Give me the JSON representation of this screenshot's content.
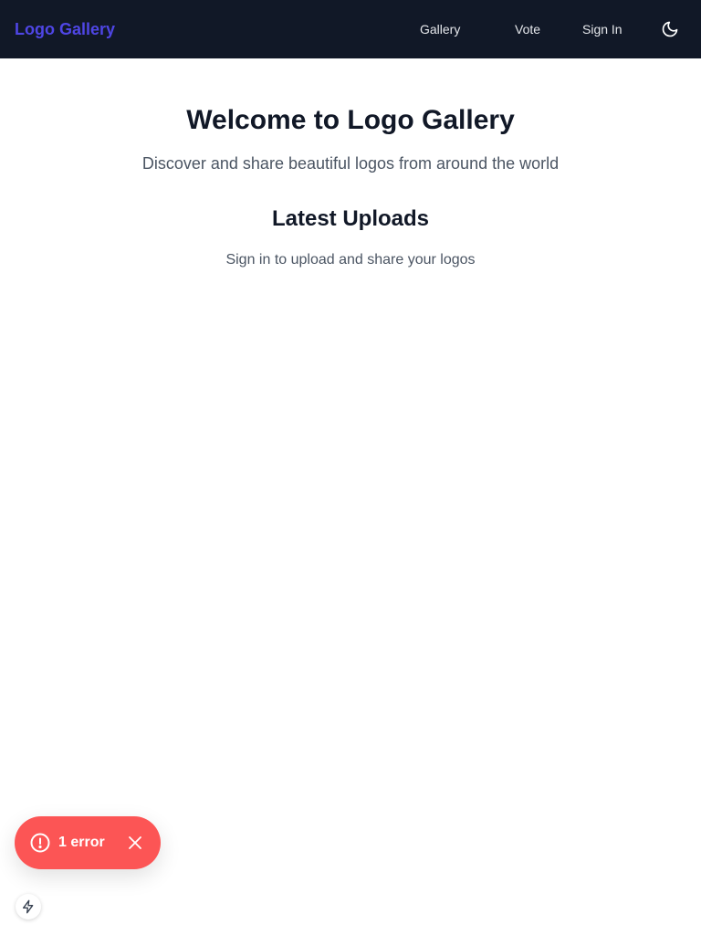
{
  "header": {
    "brand": "Logo Gallery",
    "nav": {
      "gallery": "Gallery",
      "vote": "Vote",
      "sign_in": "Sign In"
    },
    "theme_toggle_icon": "moon-icon"
  },
  "main": {
    "hero_title": "Welcome to Logo Gallery",
    "hero_subtitle": "Discover and share beautiful logos from around the world",
    "section_title": "Latest Uploads",
    "section_note": "Sign in to upload and share your logos"
  },
  "error_toast": {
    "label": "1 error",
    "icon": "alert-circle-icon",
    "close_icon": "close-icon"
  },
  "dev_indicator": {
    "icon": "lightning-icon"
  },
  "colors": {
    "navbar_bg": "#111827",
    "brand": "#4f46e5",
    "error_bg": "#fc5555"
  }
}
